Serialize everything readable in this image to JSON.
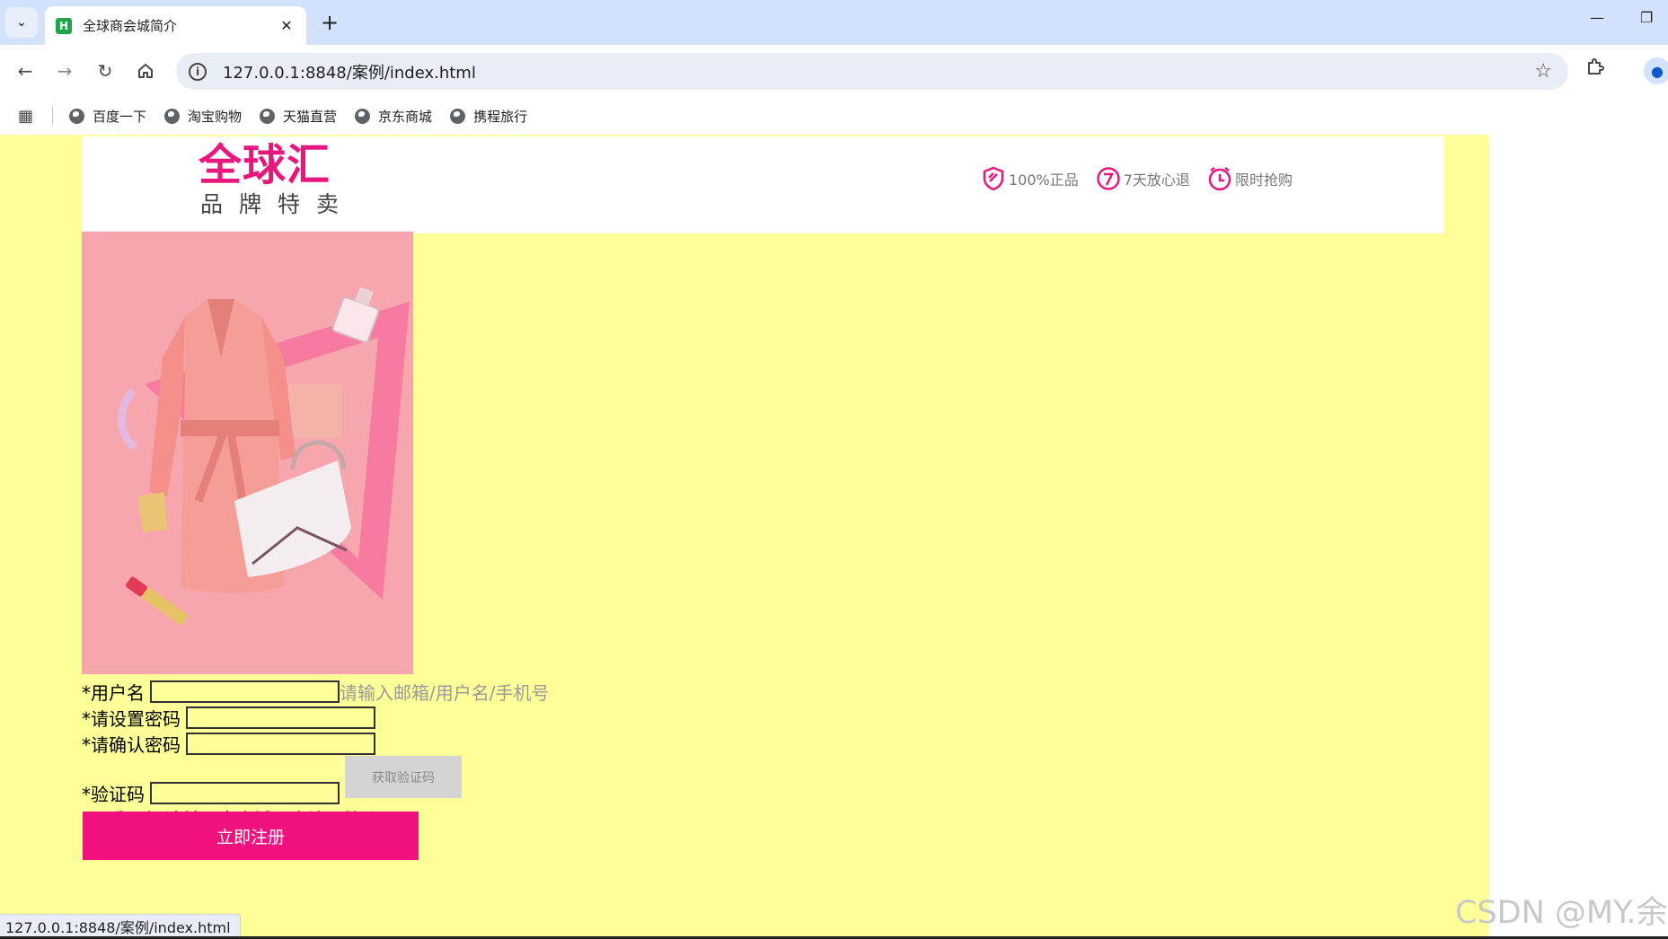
{
  "browser": {
    "tab_title": "全球商会城简介",
    "tab_favicon_letter": "H",
    "url": "127.0.0.1:8848/案例/index.html",
    "bookmarks": [
      {
        "label": "百度一下"
      },
      {
        "label": "淘宝购物"
      },
      {
        "label": "天猫直营"
      },
      {
        "label": "京东商城"
      },
      {
        "label": "携程旅行"
      }
    ]
  },
  "header": {
    "logo_main": "全球汇",
    "logo_sub": "品牌特卖",
    "features": [
      {
        "icon": "shield-icon",
        "label": "100%正品"
      },
      {
        "icon": "seven-days-icon",
        "label": "7天放心退"
      },
      {
        "icon": "clock-icon",
        "label": "限时抢购"
      }
    ]
  },
  "form": {
    "username_label": "*用户名",
    "username_hint": "请输入邮箱/用户名/手机号",
    "password_label": "*请设置密码",
    "confirm_label": "*请确认密码",
    "code_label": "*验证码",
    "get_code_label": "获取验证码",
    "agree_text": "我已阅读并同意",
    "agree_link": "商城用户注册协议",
    "submit_label": "立即注册"
  },
  "status_url": "127.0.0.1:8848/案例/index.html",
  "watermark": "CSDN @MY.余",
  "colors": {
    "page_bg": "#ffff99",
    "brand_pink": "#e8177e",
    "submit_bg": "#f2127e",
    "banner_bg": "#f7a6ad",
    "link_red": "#e60000"
  }
}
